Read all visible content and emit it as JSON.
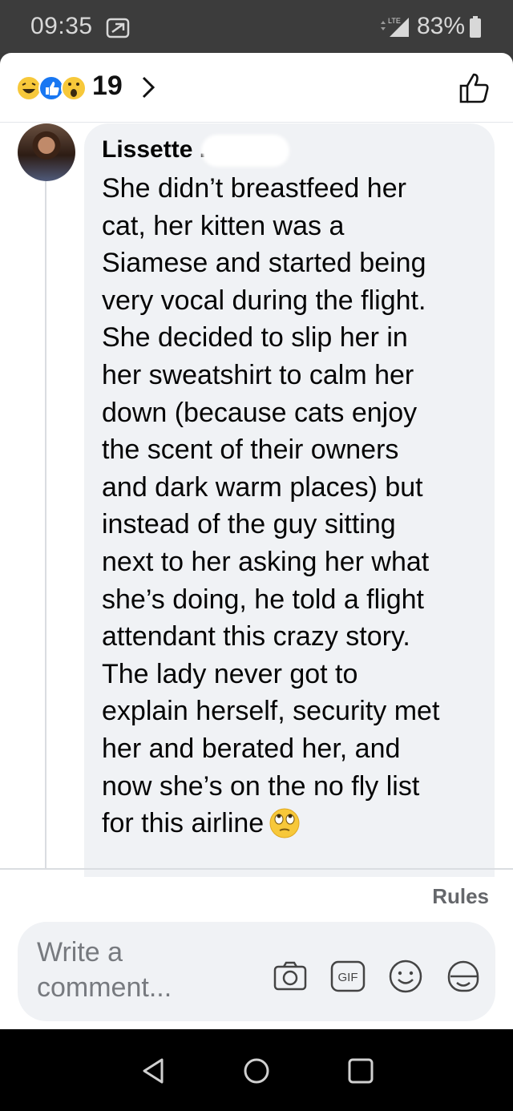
{
  "status_bar": {
    "time": "09:35",
    "battery": "83%",
    "network": "LTE"
  },
  "reactions": {
    "icons": [
      "haha-icon",
      "like-icon",
      "wow-icon"
    ],
    "count": "19"
  },
  "comment": {
    "author": "Lissette .",
    "text": "She didn’t breastfeed her\ncat, her kitten was a\nSiamese and started being\nvery vocal during the flight.\nShe decided to slip her in\nher sweatshirt to calm her\ndown (because cats enjoy\nthe scent of their owners\nand dark warm places) but\ninstead of the guy sitting\nnext to her asking her what\nshe’s doing, he told a flight\nattendant this crazy story.\nThe lady never got to\nexplain herself, security met\nher and berated her, and\nnow she’s on the no fly list\nfor this airline",
    "emoji": "face-with-rolling-eyes"
  },
  "rules_label": "Rules",
  "composer": {
    "placeholder": "Write a comment...",
    "tools": [
      "camera-icon",
      "gif-icon",
      "emoji-icon",
      "sticker-icon"
    ],
    "gif_label": "GIF"
  },
  "colors": {
    "bubble": "#f0f2f5",
    "text": "#050505",
    "muted": "#65676b",
    "like_blue": "#1877f2",
    "reaction_yellow": "#f7c83a"
  }
}
